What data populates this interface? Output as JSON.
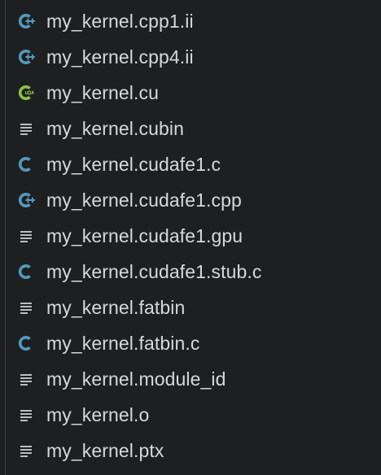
{
  "explorer": {
    "files": [
      {
        "name": "my_kernel.cpp1.ii",
        "icon": "cpp-icon"
      },
      {
        "name": "my_kernel.cpp4.ii",
        "icon": "cpp-icon"
      },
      {
        "name": "my_kernel.cu",
        "icon": "cuda-icon"
      },
      {
        "name": "my_kernel.cubin",
        "icon": "text-file-icon"
      },
      {
        "name": "my_kernel.cudafe1.c",
        "icon": "c-icon"
      },
      {
        "name": "my_kernel.cudafe1.cpp",
        "icon": "cpp-icon"
      },
      {
        "name": "my_kernel.cudafe1.gpu",
        "icon": "text-file-icon"
      },
      {
        "name": "my_kernel.cudafe1.stub.c",
        "icon": "c-icon"
      },
      {
        "name": "my_kernel.fatbin",
        "icon": "text-file-icon"
      },
      {
        "name": "my_kernel.fatbin.c",
        "icon": "c-icon"
      },
      {
        "name": "my_kernel.module_id",
        "icon": "text-file-icon"
      },
      {
        "name": "my_kernel.o",
        "icon": "text-file-icon"
      },
      {
        "name": "my_kernel.ptx",
        "icon": "text-file-icon"
      }
    ],
    "colors": {
      "background": "#1e1f21",
      "text": "#d7d8da",
      "c_icon": "#519aba",
      "cuda_icon": "#8dc149",
      "text_file_icon": "#c5c6c8"
    }
  }
}
